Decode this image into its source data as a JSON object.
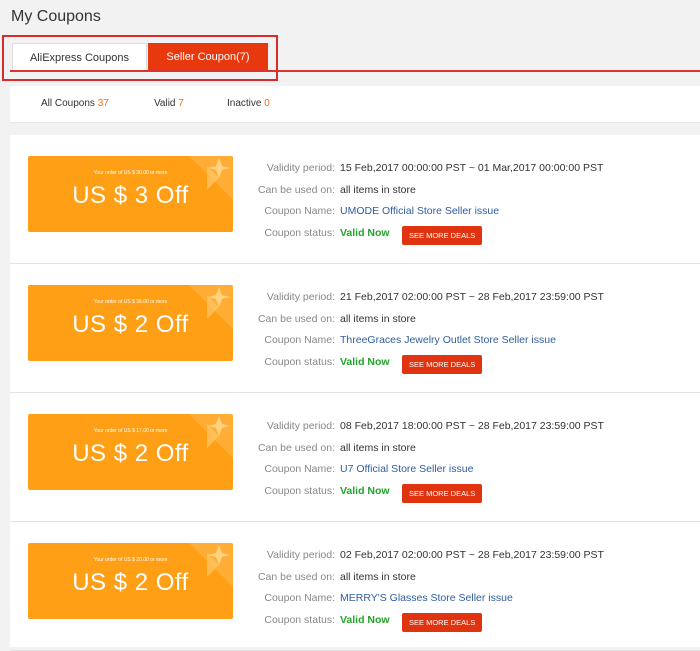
{
  "page": {
    "title": "My Coupons"
  },
  "tabs": [
    {
      "label": "AliExpress Coupons"
    },
    {
      "label": "Seller Coupon(7)"
    }
  ],
  "filters": {
    "all_label": "All Coupons",
    "all_count": "37",
    "valid_label": "Valid",
    "valid_count": "7",
    "inactive_label": "Inactive",
    "inactive_count": "0"
  },
  "labels": {
    "validity": "Validity period:",
    "usable": "Can be used on:",
    "name": "Coupon Name:",
    "status": "Coupon status:"
  },
  "coupons": [
    {
      "condition": "Your order of US $ 30.00 or more",
      "amount": "US $ 3 Off",
      "validity": "15 Feb,2017 00:00:00 PST ~ 01 Mar,2017 00:00:00 PST",
      "usable": "all items in store",
      "name": "UMODE Official Store Seller issue",
      "status": "Valid Now",
      "button": "SEE MORE DEALS"
    },
    {
      "condition": "Your order of US $ 36.00 or more",
      "amount": "US $ 2 Off",
      "validity": "21 Feb,2017 02:00:00 PST ~ 28 Feb,2017 23:59:00 PST",
      "usable": "all items in store",
      "name": "ThreeGraces Jewelry Outlet Store Seller issue",
      "status": "Valid Now",
      "button": "SEE MORE DEALS"
    },
    {
      "condition": "Your order of US $ 17.00 or more",
      "amount": "US $ 2 Off",
      "validity": "08 Feb,2017 18:00:00 PST ~ 28 Feb,2017 23:59:00 PST",
      "usable": "all items in store",
      "name": "U7 Official Store Seller issue",
      "status": "Valid Now",
      "button": "SEE MORE DEALS"
    },
    {
      "condition": "Your order of US $ 20.00 or more",
      "amount": "US $ 2 Off",
      "validity": "02 Feb,2017 02:00:00 PST ~ 28 Feb,2017 23:59:00 PST",
      "usable": "all items in store",
      "name": "MERRY'S Glasses Store Seller issue",
      "status": "Valid Now",
      "button": "SEE MORE DEALS"
    }
  ],
  "colors": {
    "accent": "#e8380d",
    "coupon": "#ff9f15",
    "status": "#22a32a",
    "link": "#2f5d9e"
  }
}
